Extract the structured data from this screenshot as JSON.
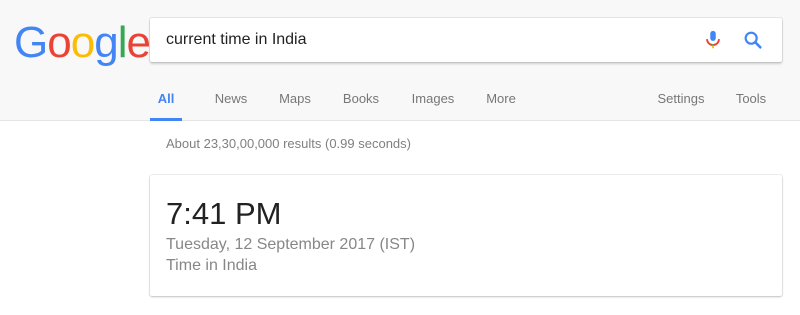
{
  "logo": {
    "letters": [
      "G",
      "o",
      "o",
      "g",
      "l",
      "e"
    ],
    "colors": [
      "#4285F4",
      "#EA4335",
      "#FBBC05",
      "#4285F4",
      "#34A853",
      "#EA4335"
    ]
  },
  "search": {
    "query": "current time in India",
    "mic_icon": "microphone-icon",
    "search_icon": "search-icon"
  },
  "tabs": {
    "all": "All",
    "news": "News",
    "maps": "Maps",
    "books": "Books",
    "images": "Images",
    "more": "More",
    "settings": "Settings",
    "tools": "Tools"
  },
  "result_stats": "About 23,30,00,000 results (0.99 seconds)",
  "time_card": {
    "time": "7:41 PM",
    "date": "Tuesday, 12 September 2017 (IST)",
    "place": "Time in India"
  },
  "colors": {
    "accent": "#4285F4",
    "header_bg": "#F8F8F8",
    "muted_text": "#777777"
  }
}
